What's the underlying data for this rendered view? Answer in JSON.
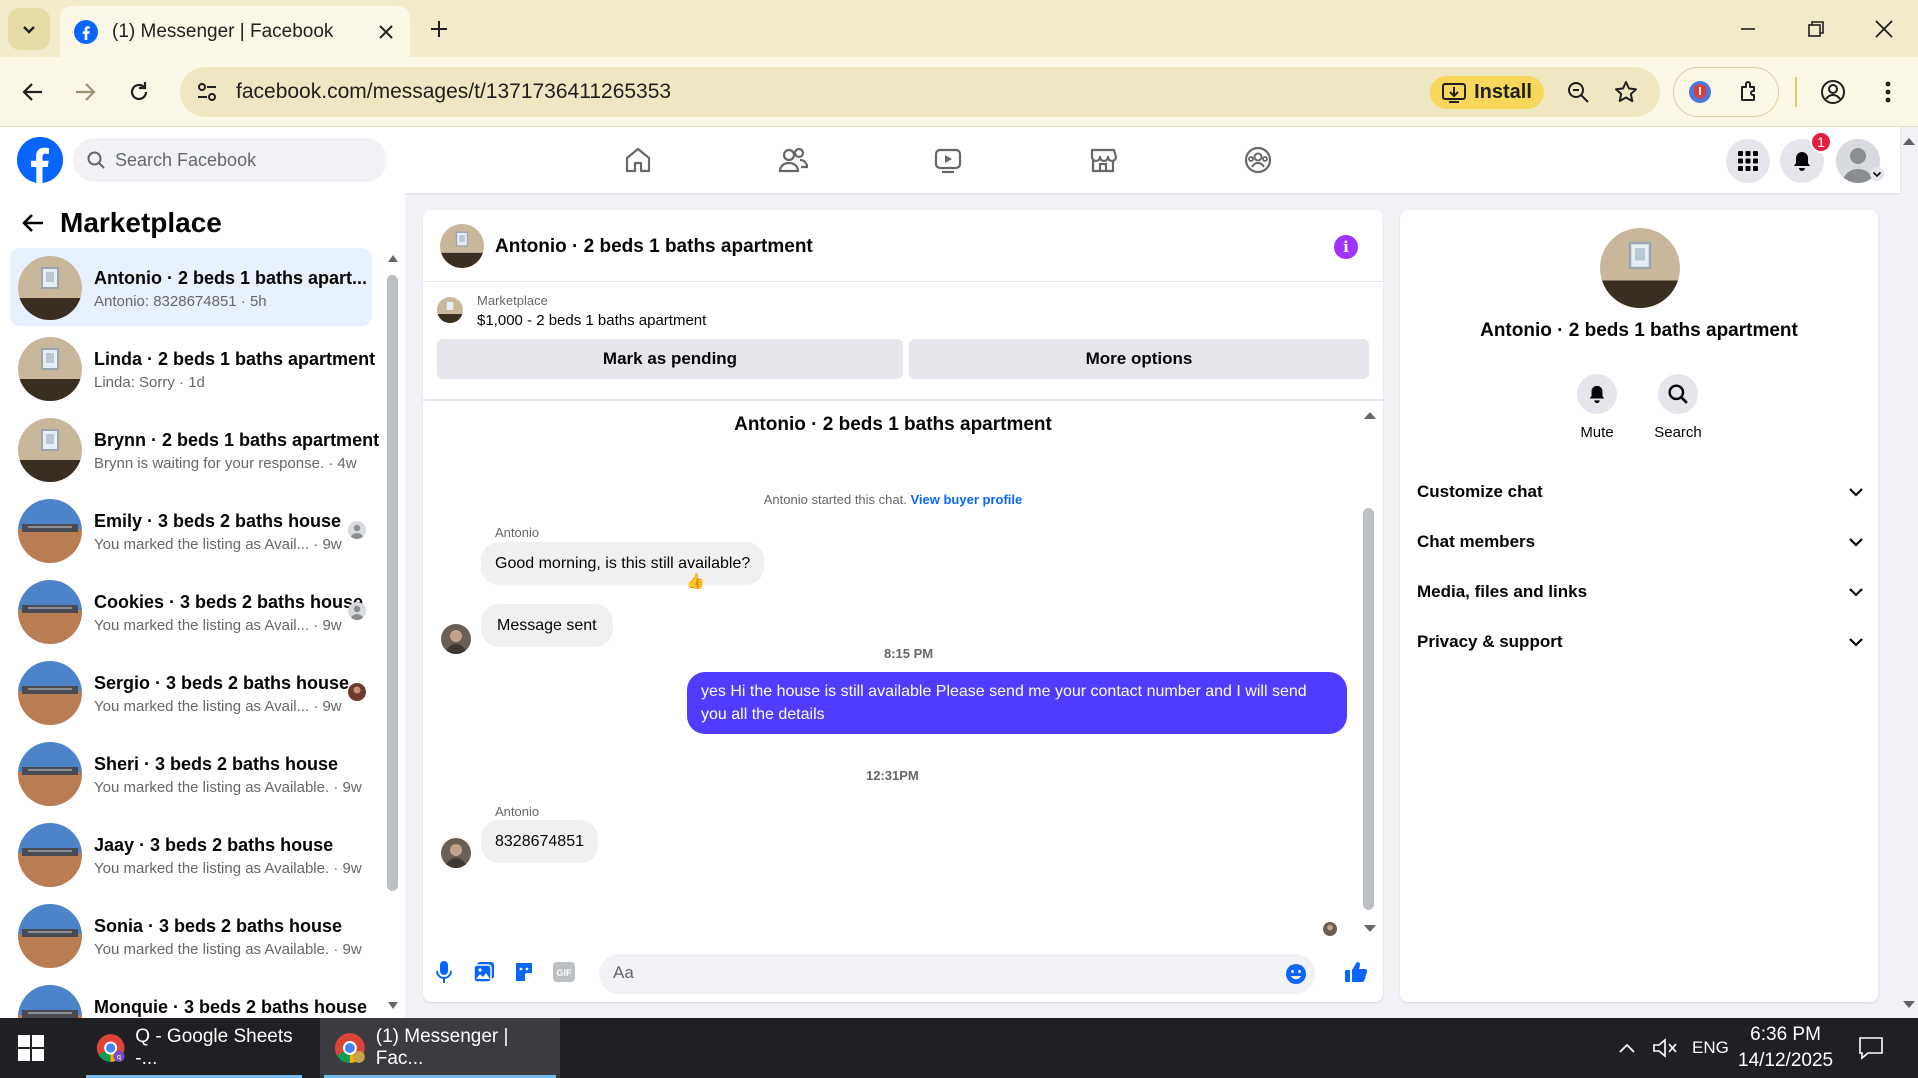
{
  "browser": {
    "tab_title": "(1) Messenger | Facebook",
    "url": "facebook.com/messages/t/1371736411265353",
    "install_label": "Install"
  },
  "fb": {
    "search_placeholder": "Search Facebook",
    "notification_count": "1"
  },
  "marketplace": {
    "title": "Marketplace",
    "conversations": [
      {
        "name": "Antonio · 2 beds 1 baths apart...",
        "preview": "Antonio: 8328674851 · 5h",
        "thumb": "apartment"
      },
      {
        "name": "Linda · 2 beds 1 baths apartment",
        "preview": "Linda: Sorry · 1d",
        "thumb": "apartment"
      },
      {
        "name": "Brynn · 2 beds 1 baths apartment",
        "preview": "Brynn is waiting for your response. · 4w",
        "thumb": "apartment"
      },
      {
        "name": "Emily · 3 beds 2 baths house",
        "preview": "You marked the listing as Avail... · 9w",
        "thumb": "house"
      },
      {
        "name": "Cookies · 3 beds 2 baths house",
        "preview": "You marked the listing as Avail... · 9w",
        "thumb": "house"
      },
      {
        "name": "Sergio · 3 beds 2 baths house",
        "preview": "You marked the listing as Avail... · 9w",
        "thumb": "house"
      },
      {
        "name": "Sheri · 3 beds 2 baths house",
        "preview": "You marked the listing as Available. · 9w",
        "thumb": "house"
      },
      {
        "name": "Jaay · 3 beds 2 baths house",
        "preview": "You marked the listing as Available. · 9w",
        "thumb": "house"
      },
      {
        "name": "Sonia · 3 beds 2 baths house",
        "preview": "You marked the listing as Available. · 9w",
        "thumb": "house"
      },
      {
        "name": "Monquie · 3 beds 2 baths house",
        "preview": "",
        "thumb": "house"
      }
    ]
  },
  "chat": {
    "title": "Antonio · 2 beds 1 baths apartment",
    "listing_label": "Marketplace",
    "listing_price": "$1,000 - 2 beds 1 baths apartment",
    "mark_pending": "Mark as pending",
    "more_options": "More options",
    "center_title": "Antonio · 2 beds 1 baths apartment",
    "started_text": "Antonio started this chat.",
    "view_buyer": "View buyer profile",
    "sender1": "Antonio",
    "msg1": "Good morning, is this still available?",
    "reaction1": "👍",
    "msg2": "Message sent",
    "time1": "8:15 PM",
    "msg3": "yes Hi the house is still available Please send me your contact number and I will send you all the details",
    "time2": "12:31PM",
    "sender2": "Antonio",
    "msg4": "8328674851",
    "composer_placeholder": "Aa"
  },
  "info": {
    "name": "Antonio · 2 beds 1 baths apartment",
    "mute": "Mute",
    "search": "Search",
    "sections": [
      "Customize chat",
      "Chat members",
      "Media, files and links",
      "Privacy & support"
    ]
  },
  "taskbar": {
    "item1": "Q - Google Sheets -...",
    "item2": "(1) Messenger | Fac...",
    "lang": "ENG",
    "time": "6:36 PM",
    "date": "14/12/2025"
  },
  "colors": {
    "fb_blue": "#0866ff",
    "outgoing_bubble": "#4f3cff",
    "active_conv": "#e7f0fd",
    "info_purple": "#a033ff"
  }
}
